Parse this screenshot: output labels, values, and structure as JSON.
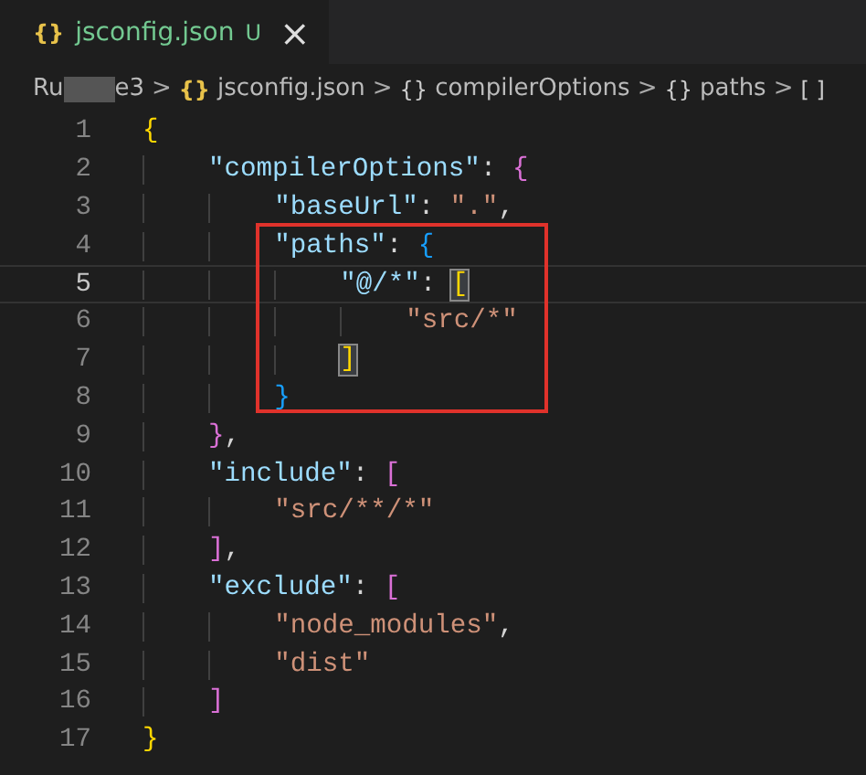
{
  "tab": {
    "icon": "{}",
    "label": "jsconfig.json",
    "status": "U",
    "close": "×",
    "selected": true
  },
  "breadcrumbs": [
    {
      "kind": "folder",
      "start": "Ru",
      "end": "e3"
    },
    {
      "kind": "file",
      "icon": "{}",
      "label": "jsconfig.json"
    },
    {
      "kind": "object",
      "icon": "{}",
      "label": "compilerOptions"
    },
    {
      "kind": "object",
      "icon": "{}",
      "label": "paths"
    },
    {
      "kind": "array",
      "icon": "[ ]"
    }
  ],
  "separator": ">",
  "lines": [
    {
      "number": "1",
      "current": false,
      "tokens": [
        {
          "text": "{",
          "kind": "brace1",
          "matched": false
        }
      ]
    },
    {
      "number": "2",
      "current": false,
      "tokens": [
        {
          "text": "    \"compilerOptions\"",
          "kind": "key",
          "matched": false
        },
        {
          "text": ": ",
          "kind": "punct",
          "matched": false
        },
        {
          "text": "{",
          "kind": "brace2",
          "matched": false
        }
      ]
    },
    {
      "number": "3",
      "current": false,
      "tokens": [
        {
          "text": "        \"baseUrl\"",
          "kind": "key",
          "matched": false
        },
        {
          "text": ": ",
          "kind": "punct",
          "matched": false
        },
        {
          "text": "\".\"",
          "kind": "string",
          "matched": false
        },
        {
          "text": ",",
          "kind": "punct",
          "matched": false
        }
      ]
    },
    {
      "number": "4",
      "current": false,
      "tokens": [
        {
          "text": "        \"paths\"",
          "kind": "key",
          "matched": false
        },
        {
          "text": ": ",
          "kind": "punct",
          "matched": false
        },
        {
          "text": "{",
          "kind": "brace3",
          "matched": false
        }
      ]
    },
    {
      "number": "5",
      "current": true,
      "tokens": [
        {
          "text": "            \"@/*\"",
          "kind": "key",
          "matched": false
        },
        {
          "text": ": ",
          "kind": "punct",
          "matched": false
        },
        {
          "text": "[",
          "kind": "brace1",
          "matched": true
        }
      ]
    },
    {
      "number": "6",
      "current": false,
      "tokens": [
        {
          "text": "                \"src/*\"",
          "kind": "string",
          "matched": false
        }
      ]
    },
    {
      "number": "7",
      "current": false,
      "tokens": [
        {
          "text": "            ]",
          "kind": "brace1",
          "matched": true
        }
      ]
    },
    {
      "number": "8",
      "current": false,
      "tokens": [
        {
          "text": "        }",
          "kind": "brace3",
          "matched": false
        }
      ]
    },
    {
      "number": "9",
      "current": false,
      "tokens": [
        {
          "text": "    }",
          "kind": "brace2",
          "matched": false
        },
        {
          "text": ",",
          "kind": "punct",
          "matched": false
        }
      ]
    },
    {
      "number": "10",
      "current": false,
      "tokens": [
        {
          "text": "    \"include\"",
          "kind": "key",
          "matched": false
        },
        {
          "text": ": ",
          "kind": "punct",
          "matched": false
        },
        {
          "text": "[",
          "kind": "brace2",
          "matched": false
        }
      ]
    },
    {
      "number": "11",
      "current": false,
      "tokens": [
        {
          "text": "        \"src/**/*\"",
          "kind": "string",
          "matched": false
        }
      ]
    },
    {
      "number": "12",
      "current": false,
      "tokens": [
        {
          "text": "    ]",
          "kind": "brace2",
          "matched": false
        },
        {
          "text": ",",
          "kind": "punct",
          "matched": false
        }
      ]
    },
    {
      "number": "13",
      "current": false,
      "tokens": [
        {
          "text": "    \"exclude\"",
          "kind": "key",
          "matched": false
        },
        {
          "text": ": ",
          "kind": "punct",
          "matched": false
        },
        {
          "text": "[",
          "kind": "brace2",
          "matched": false
        }
      ]
    },
    {
      "number": "14",
      "current": false,
      "tokens": [
        {
          "text": "        \"node_modules\"",
          "kind": "string",
          "matched": false
        },
        {
          "text": ",",
          "kind": "punct",
          "matched": false
        }
      ]
    },
    {
      "number": "15",
      "current": false,
      "tokens": [
        {
          "text": "        \"dist\"",
          "kind": "string",
          "matched": false
        }
      ]
    },
    {
      "number": "16",
      "current": false,
      "tokens": [
        {
          "text": "    ]",
          "kind": "brace2",
          "matched": false
        }
      ]
    },
    {
      "number": "17",
      "current": false,
      "tokens": [
        {
          "text": "}",
          "kind": "brace1",
          "matched": false
        }
      ]
    }
  ]
}
